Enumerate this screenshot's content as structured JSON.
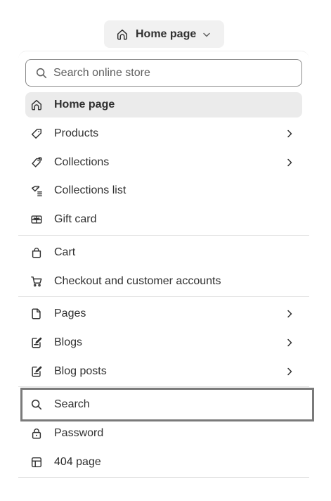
{
  "trigger": {
    "label": "Home page",
    "icon": "home-icon"
  },
  "search": {
    "placeholder": "Search online store",
    "value": ""
  },
  "menu": {
    "group1": [
      {
        "label": "Home page",
        "icon": "home-icon",
        "has_submenu": false,
        "active": true
      },
      {
        "label": "Products",
        "icon": "tag-icon",
        "has_submenu": true
      },
      {
        "label": "Collections",
        "icon": "tags-icon",
        "has_submenu": true
      },
      {
        "label": "Collections list",
        "icon": "tags-list-icon",
        "has_submenu": false
      },
      {
        "label": "Gift card",
        "icon": "gift-card-icon",
        "has_submenu": false
      }
    ],
    "group2": [
      {
        "label": "Cart",
        "icon": "bag-icon",
        "has_submenu": false
      },
      {
        "label": "Checkout and customer accounts",
        "icon": "cart-icon",
        "has_submenu": false
      }
    ],
    "group3": [
      {
        "label": "Pages",
        "icon": "page-icon",
        "has_submenu": true
      },
      {
        "label": "Blogs",
        "icon": "blog-icon",
        "has_submenu": true
      },
      {
        "label": "Blog posts",
        "icon": "blog-post-icon",
        "has_submenu": true
      }
    ],
    "group4": [
      {
        "label": "Search",
        "icon": "search-icon",
        "has_submenu": false,
        "focused": true
      },
      {
        "label": "Password",
        "icon": "lock-icon",
        "has_submenu": false
      },
      {
        "label": "404 page",
        "icon": "layout-icon",
        "has_submenu": false
      }
    ]
  }
}
